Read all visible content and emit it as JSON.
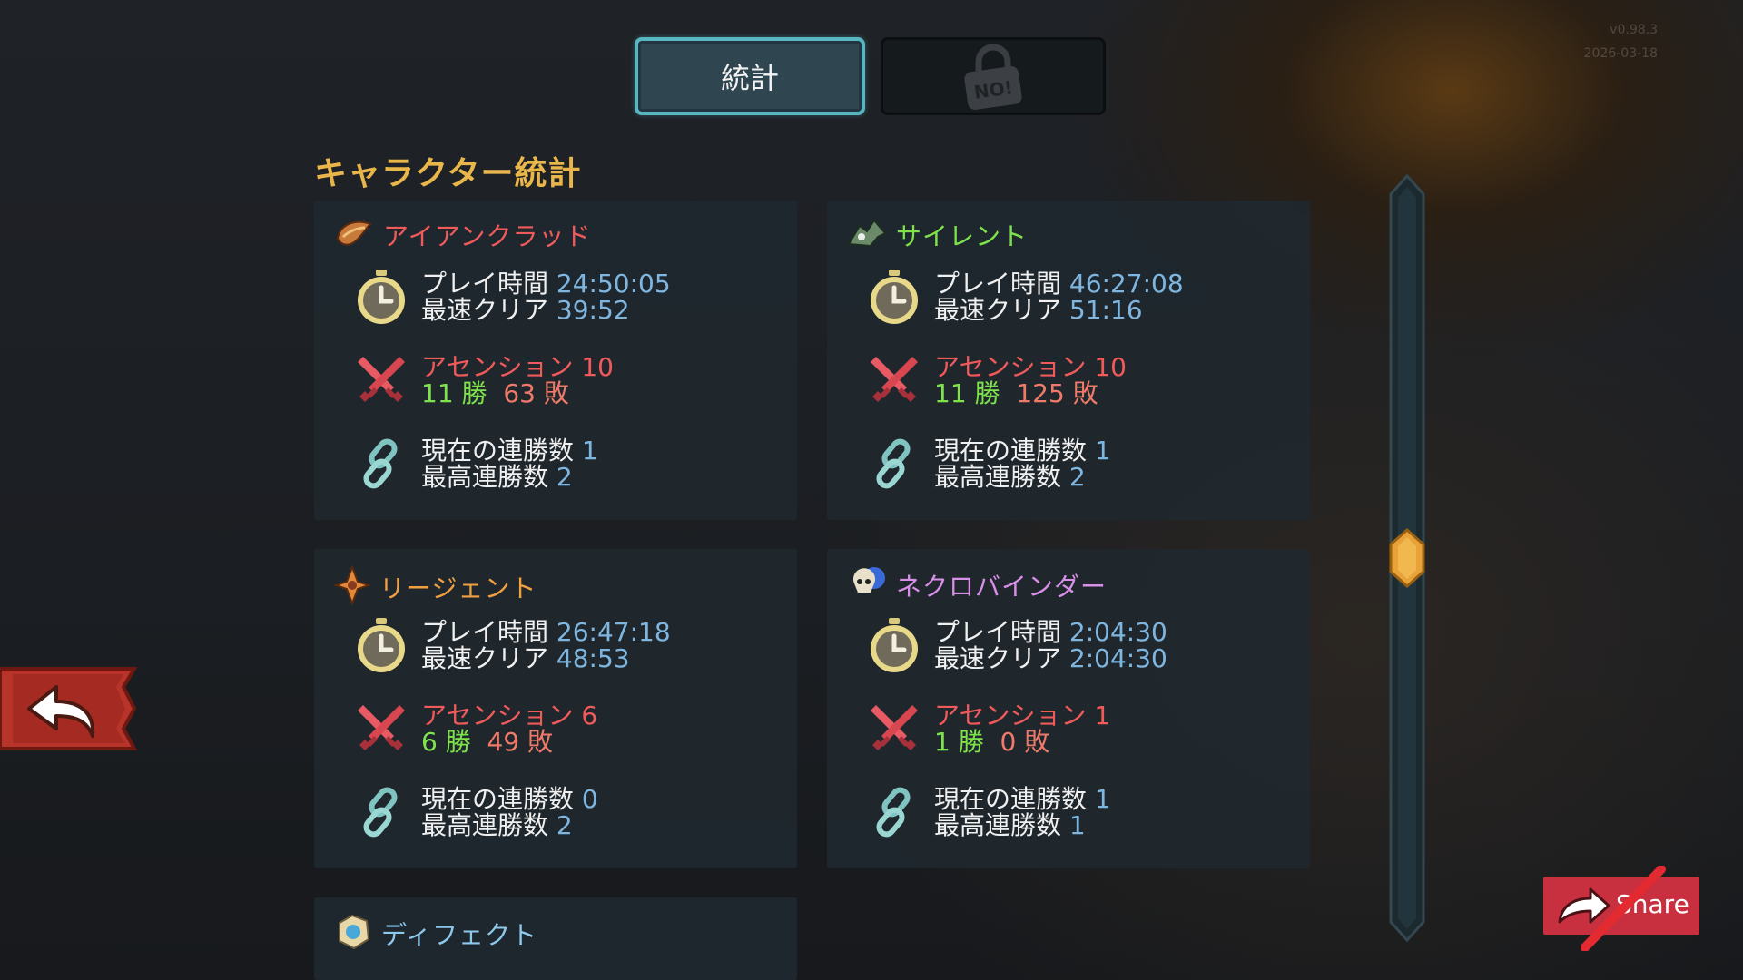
{
  "version": {
    "number": "v0.98.3",
    "date": "2026-03-18"
  },
  "tabs": {
    "stats_label": "統計",
    "locked_label": "NO!"
  },
  "section_title": "キャラクター統計",
  "labels": {
    "playtime": "プレイ時間",
    "fastest": "最速クリア",
    "ascension": "アセンション",
    "wins_suffix": "勝",
    "losses_suffix": "敗",
    "current_streak": "現在の連勝数",
    "best_streak": "最高連勝数"
  },
  "characters": [
    {
      "name": "アイアンクラッド",
      "name_color": "#f05a5a",
      "icon": "ironclad-icon",
      "playtime": "24:50:05",
      "fastest": "39:52",
      "ascension": "10",
      "wins": "11",
      "losses": "63",
      "current_streak": "1",
      "best_streak": "2"
    },
    {
      "name": "サイレント",
      "name_color": "#7ee34a",
      "icon": "silent-icon",
      "playtime": "46:27:08",
      "fastest": "51:16",
      "ascension": "10",
      "wins": "11",
      "losses": "125",
      "current_streak": "1",
      "best_streak": "2"
    },
    {
      "name": "リージェント",
      "name_color": "#f0a040",
      "icon": "regent-icon",
      "playtime": "26:47:18",
      "fastest": "48:53",
      "ascension": "6",
      "wins": "6",
      "losses": "49",
      "current_streak": "0",
      "best_streak": "2"
    },
    {
      "name": "ネクロバインダー",
      "name_color": "#d98fe8",
      "icon": "necrobinder-icon",
      "playtime": "2:04:30",
      "fastest": "2:04:30",
      "ascension": "1",
      "wins": "1",
      "losses": "0",
      "current_streak": "1",
      "best_streak": "1"
    },
    {
      "name": "ディフェクト",
      "name_color": "#8ec8ec",
      "icon": "defect-icon"
    }
  ],
  "share": {
    "label": "Share"
  },
  "scrollbar": {
    "position": 0.5
  }
}
